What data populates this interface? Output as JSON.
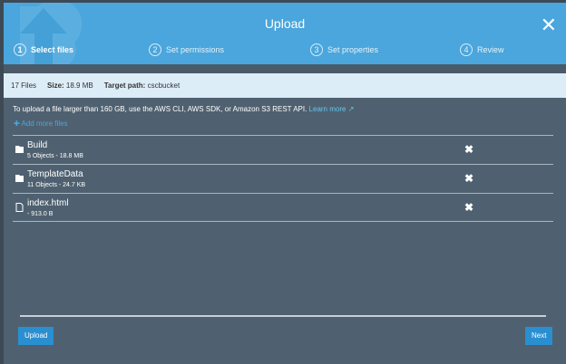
{
  "header": {
    "title": "Upload",
    "steps": [
      {
        "num": "1",
        "label": "Select files"
      },
      {
        "num": "2",
        "label": "Set permissions"
      },
      {
        "num": "3",
        "label": "Set properties"
      },
      {
        "num": "4",
        "label": "Review"
      }
    ]
  },
  "info": {
    "files": "17 Files",
    "size_label": "Size:",
    "size": "18.9 MB",
    "path_label": "Target path:",
    "path": "cscbucket"
  },
  "note": {
    "text": "To upload a file larger than 160 GB, use the AWS CLI, AWS SDK, or Amazon S3 REST API. ",
    "link": "Learn more"
  },
  "add_more": "Add more files",
  "items": [
    {
      "name": "Build",
      "meta": "5 Objects - 18.8 MB",
      "type": "folder"
    },
    {
      "name": "TemplateData",
      "meta": "11 Objects - 24.7 KB",
      "type": "folder"
    },
    {
      "name": "index.html",
      "meta": "- 913.0 B",
      "type": "file"
    }
  ],
  "footer": {
    "upload": "Upload",
    "next": "Next"
  }
}
